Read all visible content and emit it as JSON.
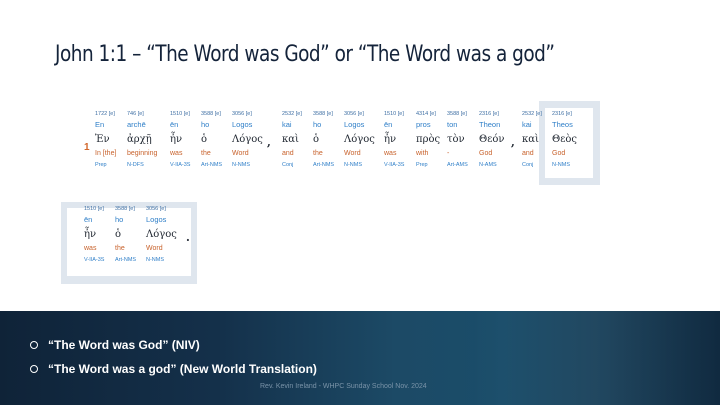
{
  "slide": {
    "title": "John 1:1 – “The Word was God” or “The Word was a god”",
    "verse_number": "1",
    "columns": [
      {
        "strong": "1722 [e]",
        "translit": "En",
        "greek": "Ἐν",
        "english": "In [the]",
        "parse": "Prep"
      },
      {
        "strong": "746 [e]",
        "translit": "archē",
        "greek": "ἀρχῇ",
        "english": "beginning",
        "parse": "N-DFS"
      },
      {
        "strong": "1510 [e]",
        "translit": "ēn",
        "greek": "ἦν",
        "english": "was",
        "parse": "V-IIA-3S"
      },
      {
        "strong": "3588 [e]",
        "translit": "ho",
        "greek": "ὁ",
        "english": "the",
        "parse": "Art-NMS"
      },
      {
        "strong": "3056 [e]",
        "translit": "Logos",
        "greek": "Λόγος",
        "english": "Word",
        "parse": "N-NMS"
      },
      {
        "strong": "2532 [e]",
        "translit": "kai",
        "greek": "καὶ",
        "english": "and",
        "parse": "Conj"
      },
      {
        "strong": "3588 [e]",
        "translit": "ho",
        "greek": "ὁ",
        "english": "the",
        "parse": "Art-NMS"
      },
      {
        "strong": "3056 [e]",
        "translit": "Logos",
        "greek": "Λόγος",
        "english": "Word",
        "parse": "N-NMS"
      },
      {
        "strong": "1510 [e]",
        "translit": "ēn",
        "greek": "ἦν",
        "english": "was",
        "parse": "V-IIA-3S"
      },
      {
        "strong": "4314 [e]",
        "translit": "pros",
        "greek": "πρὸς",
        "english": "with",
        "parse": "Prep"
      },
      {
        "strong": "3588 [e]",
        "translit": "ton",
        "greek": "τὸν",
        "english": "-",
        "parse": "Art-AMS"
      },
      {
        "strong": "2316 [e]",
        "translit": "Theon",
        "greek": "Θεόν",
        "english": "God",
        "parse": "N-AMS"
      },
      {
        "strong": "2532 [e]",
        "translit": "kai",
        "greek": "καὶ",
        "english": "and",
        "parse": "Conj"
      },
      {
        "strong": "2316 [e]",
        "translit": "Theos",
        "greek": "Θεὸς",
        "english": "God",
        "parse": "N-NMS"
      }
    ],
    "punct_comma": ",",
    "punct_period": ".",
    "snippet": [
      {
        "strong": "1510 [e]",
        "translit": "ēn",
        "greek": "ἦν",
        "english": "was",
        "parse": "V-IIA-3S"
      },
      {
        "strong": "3588 [e]",
        "translit": "ho",
        "greek": "ὁ",
        "english": "the",
        "parse": "Art-NMS"
      },
      {
        "strong": "3056 [e]",
        "translit": "Logos",
        "greek": "Λόγος",
        "english": "Word",
        "parse": "N-NMS"
      }
    ],
    "bullets": [
      "“The Word was God” (NIV)",
      "“The Word was a god” (New World Translation)"
    ],
    "footer": "Rev. Kevin Ireland - WHPC Sunday School Nov. 2024",
    "colors": {
      "title": "#14233a",
      "strong_number": "#3d6ea3",
      "transliteration": "#2f7fc8",
      "english_gloss": "#c8622c",
      "highlight_frame": "#dfe6ee",
      "band": "#1c4a66"
    },
    "icons": {
      "bullet": "hollow-circle-bullet-icon"
    }
  }
}
